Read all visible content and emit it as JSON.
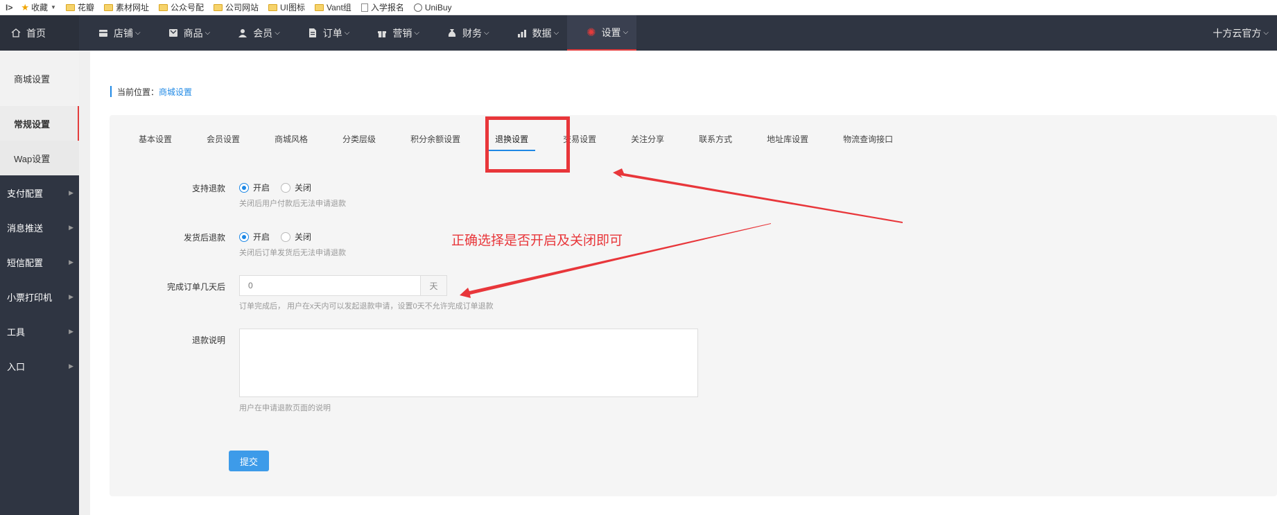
{
  "bookmarks": {
    "first": "I>",
    "items": [
      {
        "label": "收藏",
        "icon": "star-icon"
      },
      {
        "label": "花瓣",
        "icon": "folder-icon"
      },
      {
        "label": "素材网址",
        "icon": "folder-icon"
      },
      {
        "label": "公众号配",
        "icon": "folder-icon"
      },
      {
        "label": "公司网站",
        "icon": "folder-icon"
      },
      {
        "label": "UI图标",
        "icon": "folder-icon"
      },
      {
        "label": "Vant组",
        "icon": "folder-icon"
      },
      {
        "label": "入学报名",
        "icon": "document-icon"
      },
      {
        "label": "UniBuy",
        "icon": "globe-icon"
      }
    ]
  },
  "topnav": {
    "home": "首页",
    "items": [
      {
        "label": "店铺",
        "icon": "store-icon"
      },
      {
        "label": "商品",
        "icon": "goods-icon"
      },
      {
        "label": "会员",
        "icon": "user-icon"
      },
      {
        "label": "订单",
        "icon": "order-icon"
      },
      {
        "label": "营销",
        "icon": "gift-icon"
      },
      {
        "label": "财务",
        "icon": "money-bag-icon"
      },
      {
        "label": "数据",
        "icon": "bar-chart-icon"
      },
      {
        "label": "设置",
        "icon": "gear-icon"
      }
    ],
    "account": "十方云官方"
  },
  "sidebar": {
    "sub_items": [
      "商城设置",
      "常规设置",
      "Wap设置"
    ],
    "groups": [
      "支付配置",
      "消息推送",
      "短信配置",
      "小票打印机",
      "工具",
      "入口"
    ]
  },
  "breadcrumb": {
    "prefix": "当前位置：",
    "current": "商城设置"
  },
  "tabs": [
    "基本设置",
    "会员设置",
    "商城风格",
    "分类层级",
    "积分余额设置",
    "退换设置",
    "交易设置",
    "关注分享",
    "联系方式",
    "地址库设置",
    "物流查询接口"
  ],
  "active_tab": "退换设置",
  "form": {
    "refund": {
      "label": "支持退款",
      "on": "开启",
      "off": "关闭",
      "selected": "开启",
      "hint": "关闭后用户付款后无法申请退款"
    },
    "ship_refund": {
      "label": "发货后退款",
      "on": "开启",
      "off": "关闭",
      "selected": "开启",
      "hint": "关闭后订单发货后无法申请退款"
    },
    "days": {
      "label": "完成订单几天后",
      "placeholder": "0",
      "unit": "天",
      "hint": "订单完成后， 用户在x天内可以发起退款申请，设置0天不允许完成订单退款"
    },
    "desc": {
      "label": "退款说明",
      "value": "",
      "hint": "用户在申请退款页面的说明"
    },
    "submit": "提交"
  },
  "annotation": {
    "text": "正确选择是否开启及关闭即可",
    "color": "#e8363a"
  },
  "colors": {
    "nav_bg": "#2f3542",
    "accent": "#1e88e5",
    "active_red": "#e33b3b",
    "button": "#3d9be9"
  }
}
